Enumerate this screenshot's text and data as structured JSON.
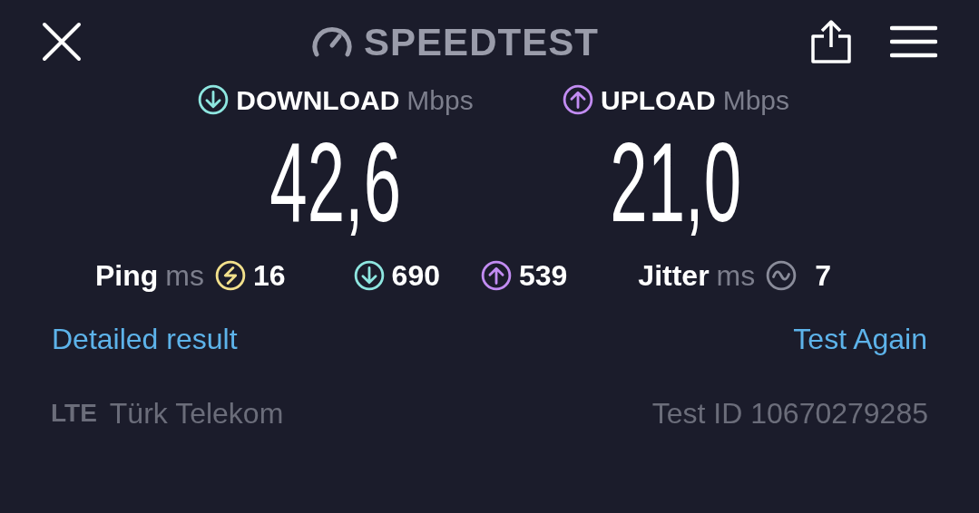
{
  "header": {
    "title": "SPEEDTEST"
  },
  "results": [
    {
      "kind": "download",
      "label": "DOWNLOAD",
      "unit": "Mbps",
      "value": "42,6",
      "color": "#8ee6e0"
    },
    {
      "kind": "upload",
      "label": "UPLOAD",
      "unit": "Mbps",
      "value": "21,0",
      "color": "#c28cf2"
    }
  ],
  "stats": [
    {
      "kind": "ping",
      "label": "Ping",
      "unit": "ms",
      "value": "16",
      "color": "#f2e08c"
    },
    {
      "kind": "download",
      "value": "690",
      "color": "#8ee6e0"
    },
    {
      "kind": "upload",
      "value": "539",
      "color": "#c28cf2"
    },
    {
      "kind": "jitter",
      "label": "Jitter",
      "unit": "ms",
      "value": "7",
      "color": "#8a8c9a"
    }
  ],
  "links": [
    "Detailed result",
    "Test Again"
  ],
  "footer": {
    "network_type": "LTE",
    "provider": "Türk Telekom",
    "test_id": "Test ID 10670279285"
  }
}
